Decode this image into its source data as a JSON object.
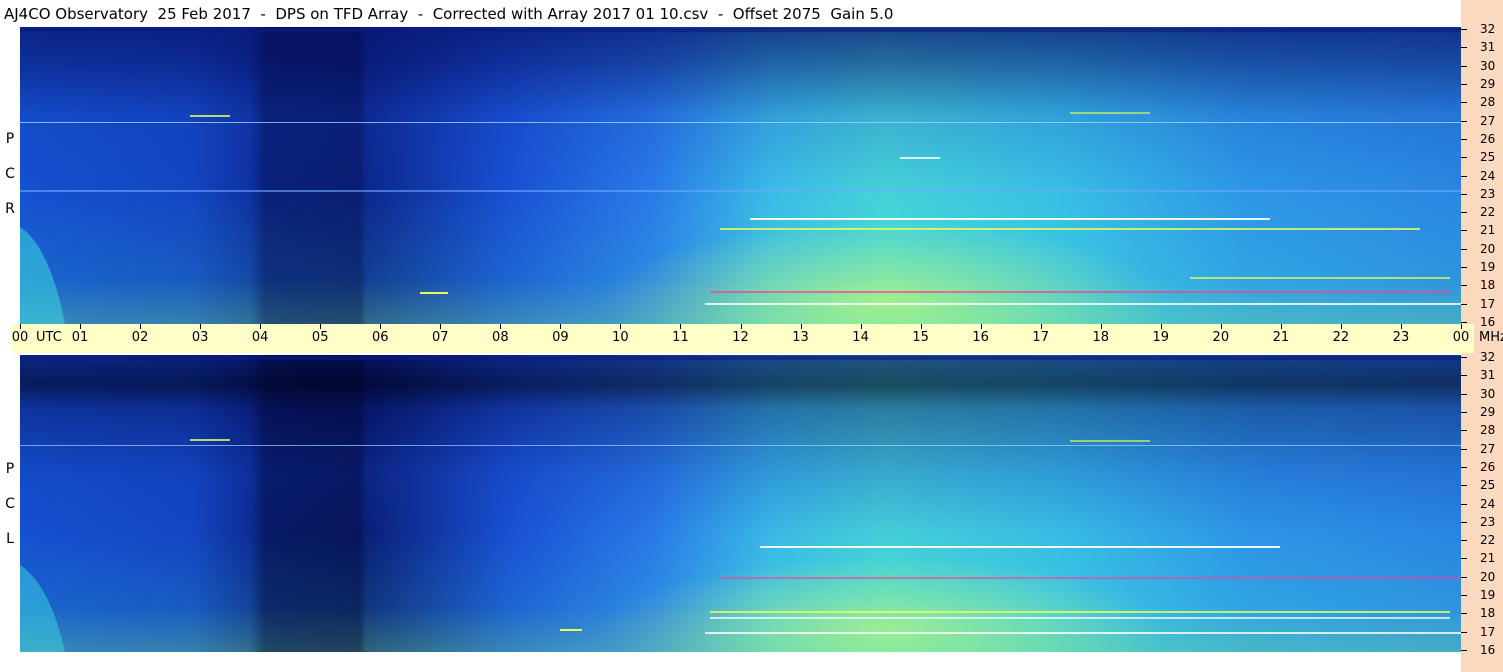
{
  "title": "AJ4CO Observatory  25 Feb 2017  -  DPS on TFD Array  -  Corrected with Array 2017 01 10.csv  -  Offset 2075  Gain 5.0",
  "panels": [
    {
      "id": "rcp",
      "label_letters": [
        "P",
        "C",
        "R"
      ]
    },
    {
      "id": "lcp",
      "label_letters": [
        "P",
        "C",
        "L"
      ]
    }
  ],
  "time_axis": {
    "unit_label": "UTC",
    "freq_unit_label": "MHz",
    "labels": [
      "00",
      "01",
      "02",
      "03",
      "04",
      "05",
      "06",
      "07",
      "08",
      "09",
      "10",
      "11",
      "12",
      "13",
      "14",
      "15",
      "16",
      "17",
      "18",
      "19",
      "20",
      "21",
      "22",
      "23",
      "00"
    ]
  },
  "freq_axis": {
    "labels": [
      "32",
      "31",
      "30",
      "29",
      "28",
      "27",
      "26",
      "25",
      "24",
      "23",
      "22",
      "21",
      "20",
      "19",
      "18",
      "17",
      "16"
    ]
  },
  "colors": {
    "background_low": "#0a1f8f",
    "background_mid": "#1a5ae0",
    "activity_high": "#3cc8e6",
    "burst_hot": "#e8ff5a",
    "burst_peak": "#ff3a9a",
    "axis_band": "#ffffc8",
    "freq_strip": "#fbd9bf"
  },
  "chart_data": {
    "type": "heatmap",
    "title": "AJ4CO Observatory  25 Feb 2017  -  DPS on TFD Array  -  Corrected with Array 2017 01 10.csv  -  Offset 2075  Gain 5.0",
    "xlabel": "UTC",
    "ylabel": "MHz",
    "x_ticks": [
      "00",
      "01",
      "02",
      "03",
      "04",
      "05",
      "06",
      "07",
      "08",
      "09",
      "10",
      "11",
      "12",
      "13",
      "14",
      "15",
      "16",
      "17",
      "18",
      "19",
      "20",
      "21",
      "22",
      "23",
      "00"
    ],
    "y_ticks": [
      32,
      31,
      30,
      29,
      28,
      27,
      26,
      25,
      24,
      23,
      22,
      21,
      20,
      19,
      18,
      17,
      16
    ],
    "xlim_hours": [
      0,
      24
    ],
    "ylim_mhz": [
      16,
      32
    ],
    "panels": [
      "RCP",
      "LCP"
    ]
  }
}
